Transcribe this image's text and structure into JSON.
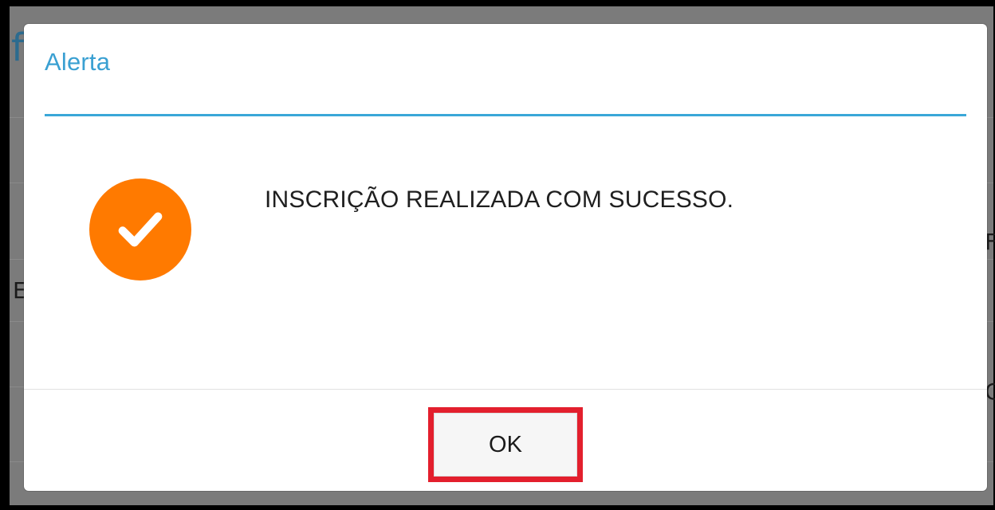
{
  "dialog": {
    "title": "Alerta",
    "message": "INSCRIÇÃO REALIZADA COM SUCESSO.",
    "icon": "check-circle-icon",
    "icon_color": "#ff7a00",
    "accent_color": "#3aa7d8",
    "ok_label": "OK",
    "highlight_color": "#e31f2d"
  },
  "background": {
    "fragments": [
      "f",
      "E",
      "F",
      "C"
    ]
  }
}
